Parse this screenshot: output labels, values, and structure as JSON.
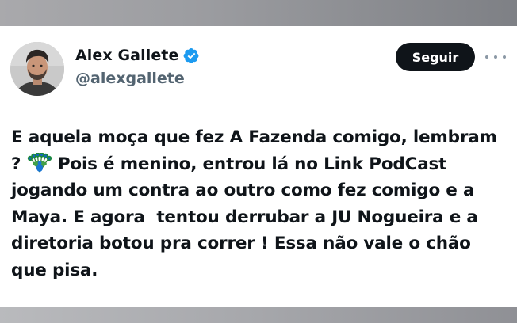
{
  "tweet": {
    "author": {
      "display_name": "Alex Gallete",
      "handle": "@alexgallete",
      "verified": true,
      "verified_icon": "verified-badge-icon"
    },
    "follow_label": "Seguir",
    "more_icon": "more-options-icon",
    "text_part1": "E aquela moça que fez A Fazenda comigo, lembram ? ",
    "emoji_icon": "peacock-emoji-icon",
    "text_part2": " Pois é menino, entrou lá no Link PodCast jogando um contra ao outro como fez comigo e a Maya. E agora  tentou derrubar a JU Nogueira e a diretoria botou pra correr ! Essa não vale o chão que pisa."
  },
  "colors": {
    "text_primary": "#0f1419",
    "text_secondary": "#536471",
    "verified_blue": "#1d9bf0",
    "button_bg": "#0f1419",
    "button_text": "#ffffff"
  }
}
